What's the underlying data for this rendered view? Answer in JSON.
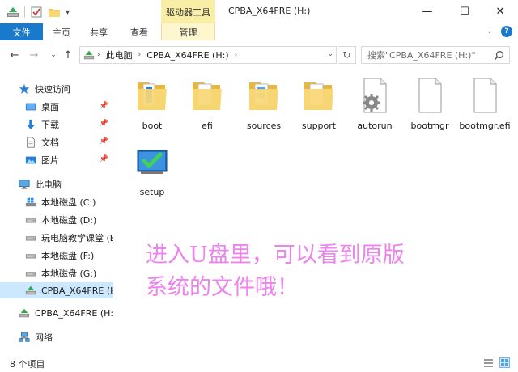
{
  "titlebar": {
    "context_tab": "驱动器工具",
    "title": "CPBA_X64FRE (H:)",
    "qa_dropdown": "▾"
  },
  "window_controls": {
    "minimize": "—",
    "maximize": "☐",
    "close": "✕"
  },
  "ribbon": {
    "tabs": [
      {
        "label": "文件",
        "active": true
      },
      {
        "label": "主页"
      },
      {
        "label": "共享"
      },
      {
        "label": "查看"
      },
      {
        "label": "管理",
        "context": true
      }
    ]
  },
  "address": {
    "crumbs": [
      "此电脑",
      "CPBA_X64FRE (H:)"
    ],
    "search_placeholder": "搜索\"CPBA_X64FRE (H:)\""
  },
  "nav": {
    "items": [
      {
        "label": "快速访问",
        "icon": "star-icon"
      },
      {
        "label": "桌面",
        "icon": "desktop-icon",
        "pinned": true
      },
      {
        "label": "下载",
        "icon": "download-icon",
        "pinned": true
      },
      {
        "label": "文档",
        "icon": "document-icon",
        "pinned": true
      },
      {
        "label": "图片",
        "icon": "pictures-icon",
        "pinned": true
      },
      {
        "label": "此电脑",
        "icon": "computer-icon"
      },
      {
        "label": "本地磁盘 (C:)",
        "icon": "windows-drive-icon"
      },
      {
        "label": "本地磁盘 (D:)",
        "icon": "drive-icon"
      },
      {
        "label": "玩电脑教学课堂 (E",
        "icon": "drive-icon"
      },
      {
        "label": "本地磁盘 (F:)",
        "icon": "drive-icon"
      },
      {
        "label": "本地磁盘 (G:)",
        "icon": "drive-icon"
      },
      {
        "label": "CPBA_X64FRE (H:",
        "icon": "usb-drive-icon",
        "selected": true
      },
      {
        "label": "CPBA_X64FRE (H:)",
        "icon": "usb-drive-icon"
      },
      {
        "label": "网络",
        "icon": "network-icon"
      }
    ]
  },
  "files": [
    {
      "name": "boot",
      "type": "folder"
    },
    {
      "name": "efi",
      "type": "folder"
    },
    {
      "name": "sources",
      "type": "folder"
    },
    {
      "name": "support",
      "type": "folder"
    },
    {
      "name": "autorun",
      "type": "settings"
    },
    {
      "name": "bootmgr",
      "type": "file"
    },
    {
      "name": "bootmgr.efi",
      "type": "file"
    },
    {
      "name": "setup",
      "type": "exe"
    }
  ],
  "overlay_text": [
    "进入U盘里，可以看到原版",
    "系统的文件哦！"
  ],
  "status": {
    "count": "8 个项目"
  },
  "colors": {
    "accent": "#1979ca",
    "context_tab": "#f9eea5",
    "selected": "#cce8ff",
    "overlay": "#ee82ee"
  }
}
